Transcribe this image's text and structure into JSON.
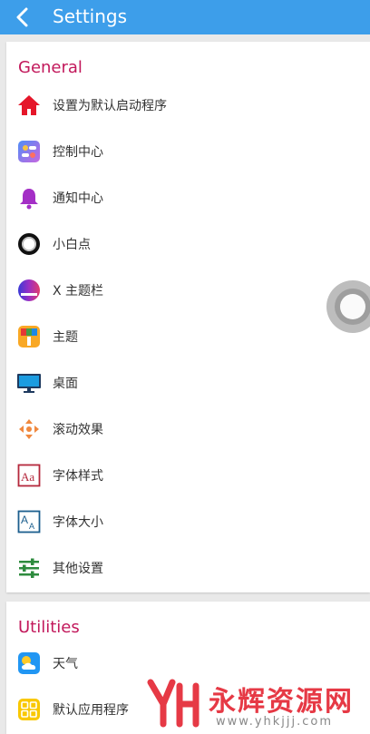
{
  "header": {
    "title": "Settings",
    "back_icon": "chevron-left-icon"
  },
  "colors": {
    "header_bg": "#3d9eea",
    "section_title": "#c2185b",
    "page_bg": "#e9e9e9"
  },
  "general": {
    "title": "General",
    "items": [
      {
        "label": "设置为默认启动程序",
        "icon": "home-icon"
      },
      {
        "label": "控制中心",
        "icon": "control-center-icon"
      },
      {
        "label": "通知中心",
        "icon": "bell-icon"
      },
      {
        "label": "小白点",
        "icon": "ring-icon"
      },
      {
        "label": "X 主题栏",
        "icon": "theme-bar-icon"
      },
      {
        "label": "主题",
        "icon": "paint-roller-icon"
      },
      {
        "label": "桌面",
        "icon": "monitor-icon"
      },
      {
        "label": "滚动效果",
        "icon": "scroll-arrows-icon"
      },
      {
        "label": "字体样式",
        "icon": "font-style-icon"
      },
      {
        "label": "字体大小",
        "icon": "font-size-icon"
      },
      {
        "label": "其他设置",
        "icon": "sliders-icon"
      }
    ]
  },
  "utilities": {
    "title": "Utilities",
    "items": [
      {
        "label": "天气",
        "icon": "weather-icon"
      },
      {
        "label": "默认应用程序",
        "icon": "apps-grid-icon"
      }
    ]
  },
  "watermark": {
    "text": "永辉资源网",
    "url": "www.yhkjjj.com"
  }
}
